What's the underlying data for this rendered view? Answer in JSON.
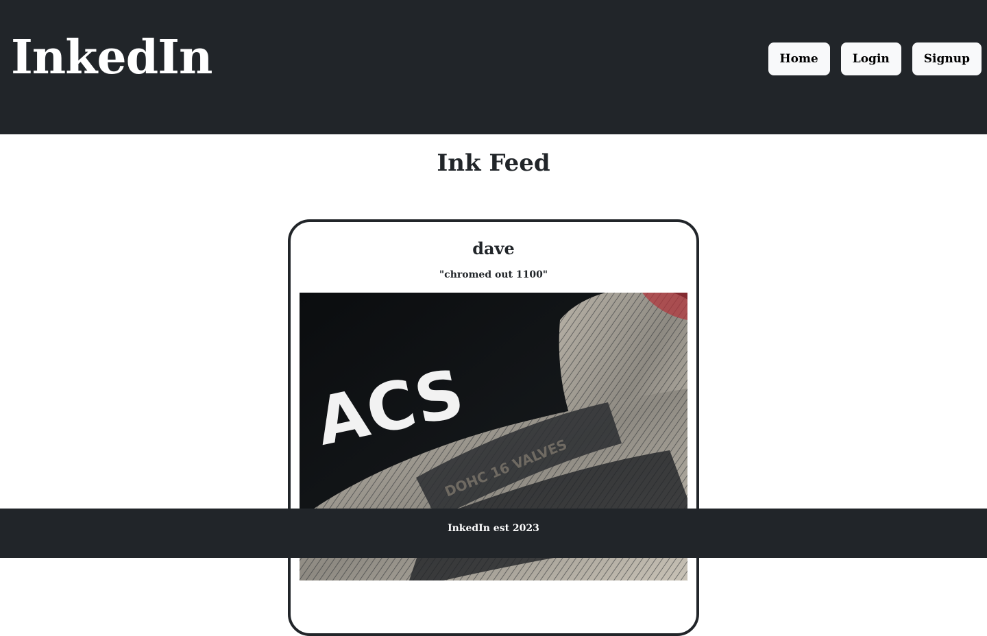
{
  "header": {
    "logo": "InkedIn",
    "nav": {
      "home_label": "Home",
      "login_label": "Login",
      "signup_label": "Signup"
    }
  },
  "main": {
    "title": "Ink Feed",
    "posts": [
      {
        "username": "dave",
        "caption": "\"chromed out 1100\"",
        "image_text": "ACS",
        "tattoo_text": "DOHC 16 VALVES"
      }
    ]
  },
  "footer": {
    "text": "InkedIn est 2023"
  },
  "colors": {
    "header_bg": "#212529",
    "button_bg": "#f8f9fa",
    "text_dark": "#212529",
    "card_border": "#212529"
  }
}
